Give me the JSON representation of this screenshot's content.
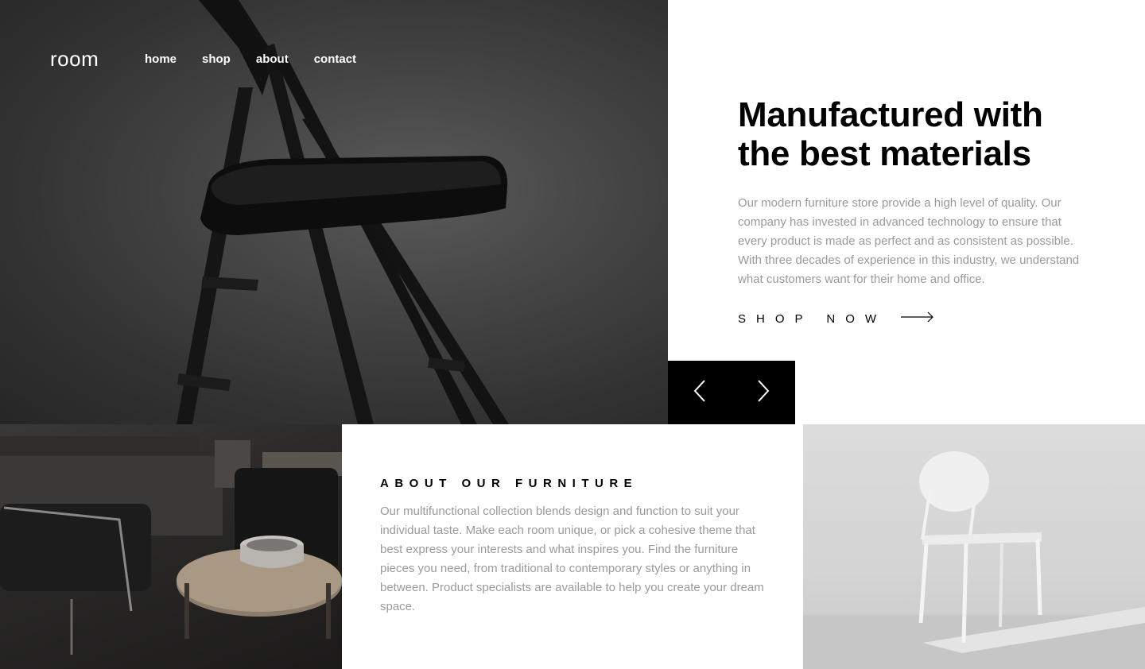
{
  "header": {
    "logo": "room",
    "nav": [
      "home",
      "shop",
      "about",
      "contact"
    ]
  },
  "hero": {
    "title_line1": "Manufactured with",
    "title_line2": "the best materials",
    "description": "Our modern furniture store provide a high level of quality. Our company has invested in advanced technology to ensure that every product is made as perfect and as consistent as possible. With three decades of experience in this industry, we understand what customers want for their home and office.",
    "cta_label": "SHOP NOW",
    "cta_icon": "arrow-right-icon"
  },
  "slider": {
    "prev_icon": "chevron-left-icon",
    "next_icon": "chevron-right-icon"
  },
  "about": {
    "title": "ABOUT OUR FURNITURE",
    "text": "Our multifunctional collection blends design and function to suit your individual taste. Make each room unique, or pick a cohesive theme that best express your interests and what inspires you. Find the furniture pieces you need, from traditional to contemporary styles or anything in between. Product specialists are available to help you create your dream space."
  },
  "colors": {
    "text_primary": "#000000",
    "text_muted": "#9a9a9a",
    "background": "#ffffff"
  }
}
